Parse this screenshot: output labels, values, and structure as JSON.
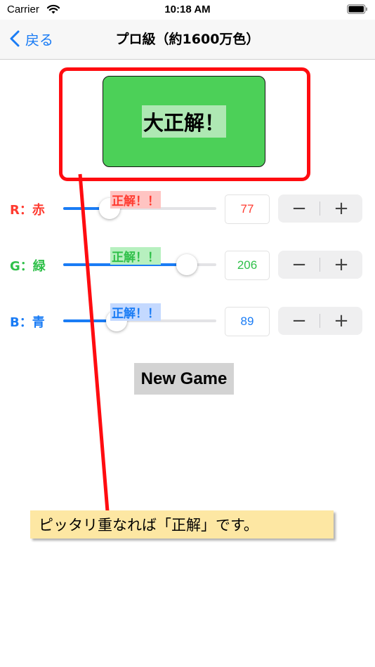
{
  "status_bar": {
    "carrier": "Carrier",
    "time": "10:18 AM"
  },
  "nav": {
    "back_label": "戻る",
    "title": "プロ級（約1600万色）"
  },
  "result": {
    "text": "大正解！",
    "box_color": "#4cd058"
  },
  "channels": [
    {
      "label": "R：赤",
      "label_color": "#ff3b30",
      "badge": "正解！！",
      "badge_bg": "#ffc4c2",
      "badge_color": "#ff3b30",
      "value": "77",
      "value_color": "#ff3b30",
      "level": 0.302
    },
    {
      "label": "G：緑",
      "label_color": "#30c04a",
      "badge": "正解！！",
      "badge_bg": "#b7f0bf",
      "badge_color": "#30c04a",
      "value": "206",
      "value_color": "#30c04a",
      "level": 0.808
    },
    {
      "label": "B：青",
      "label_color": "#1a7cf5",
      "badge": "正解！！",
      "badge_bg": "#c4d9ff",
      "badge_color": "#1a7cf5",
      "value": "89",
      "value_color": "#1a7cf5",
      "level": 0.349
    }
  ],
  "stepper": {
    "minus": "−",
    "plus": "+"
  },
  "new_game": {
    "label": "New Game"
  },
  "callout": {
    "text": "ピッタリ重なれば「正解」です。"
  },
  "colors": {
    "accent": "#1a7cf5",
    "annotation": "#ff0c10"
  }
}
